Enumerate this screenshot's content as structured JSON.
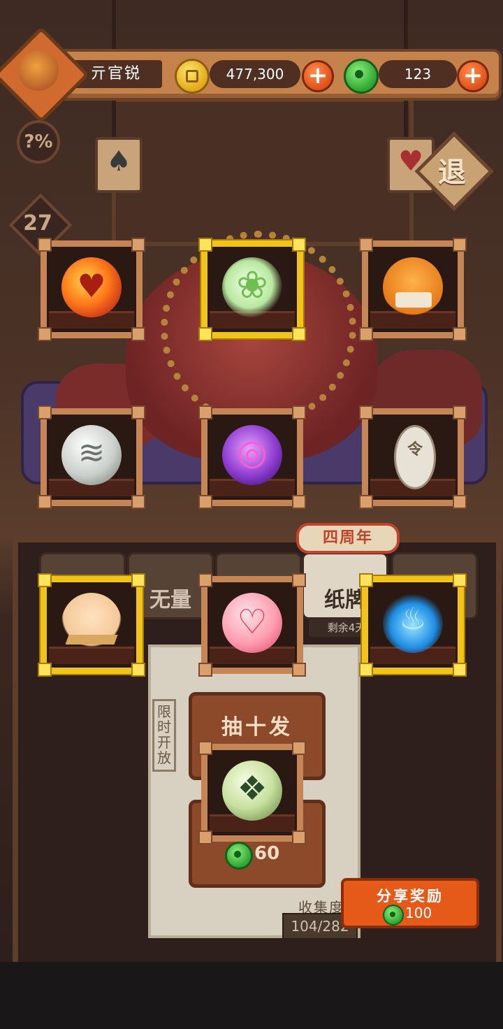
{
  "player": {
    "name": "亓官锐"
  },
  "resources": {
    "gold": {
      "value": "477,300"
    },
    "jade": {
      "value": "123"
    }
  },
  "side": {
    "odds_label": "?%",
    "level": "27",
    "retreat_label": "退"
  },
  "reward_cards": [
    {
      "id": "fire-heart-orb",
      "rarity": "normal"
    },
    {
      "id": "leaf-spirit",
      "rarity": "gold"
    },
    {
      "id": "duck-scroll",
      "rarity": "normal"
    },
    {
      "id": "whirlwind-orb",
      "rarity": "normal"
    },
    {
      "id": "purple-eye-orb",
      "rarity": "normal"
    },
    {
      "id": "order-talisman",
      "rarity": "normal"
    },
    {
      "id": "paper-boat-child",
      "rarity": "gold"
    },
    {
      "id": "pink-heart-orb",
      "rarity": "normal"
    },
    {
      "id": "blue-flame",
      "rarity": "gold"
    },
    {
      "id": "jade-crystal-orb",
      "rarity": "normal"
    }
  ],
  "tabs": {
    "tab2_label": "无量",
    "tab4_label": "纸牌",
    "anniversary_badge": "四周年",
    "remaining": "剩余4天"
  },
  "draw": {
    "limited_label": "限时开放",
    "ten_draw_label": "抽十发",
    "single_cost": "60"
  },
  "collection": {
    "label": "收集度",
    "progress": "104/282"
  },
  "share": {
    "label": "分享奖励",
    "reward": "100"
  },
  "colors": {
    "gold_frame": "#f2c318",
    "wood_frame": "#c58554",
    "share_button": "#e55a18",
    "plus_button": "#e0501a"
  }
}
